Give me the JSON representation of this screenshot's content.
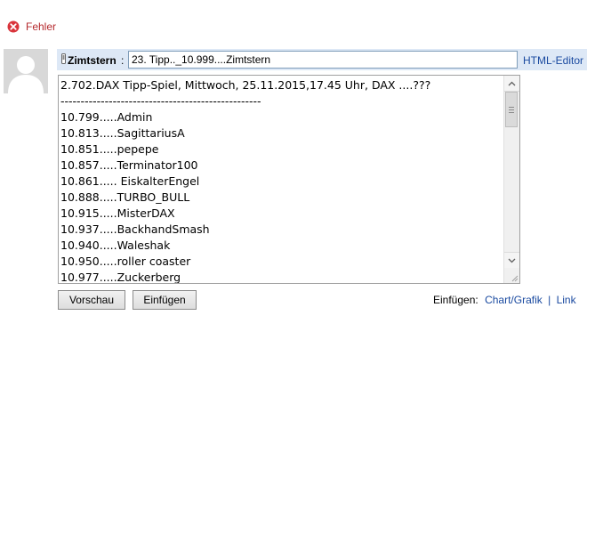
{
  "error": {
    "label": "Fehler",
    "color": "#b5292d"
  },
  "editor": {
    "username": "Zimtstern",
    "colon": ":",
    "title_value": "23. Tipp.._10.999....Zimtstern",
    "html_editor_label": "HTML-Editor",
    "header_bg": "#dde8f6",
    "body_text": "2.702.DAX Tipp-Spiel, Mittwoch, 25.11.2015,17.45 Uhr, DAX ....???\n--------------------------------------------------\n10.799.....Admin\n10.813.....SagittariusA\n10.851.....pepepe\n10.857.....Terminator100\n10.861..... EiskalterEngel\n10.888.....TURBO_BULL\n10.915.....MisterDAX\n10.937.....BackhandSmash\n10.940.....Waleshak\n10.950.....roller coaster\n10.977.....Zuckerberg"
  },
  "buttons": {
    "preview": "Vorschau",
    "insert": "Einfügen"
  },
  "insert_links": {
    "label": "Einfügen:",
    "chart": "Chart/Grafik",
    "separator": "|",
    "link": "Link",
    "link_color": "#1a4aa0"
  }
}
